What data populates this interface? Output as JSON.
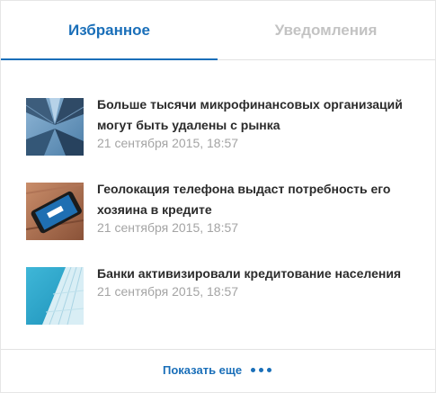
{
  "tabs": [
    {
      "label": "Избранное",
      "active": true
    },
    {
      "label": "Уведомления",
      "active": false
    }
  ],
  "news": [
    {
      "title": "Больше тысячи микрофинансовых организаций могут быть удалены с рынка",
      "date": "21 сентября 2015, 18:57",
      "thumb": "skyscrapers-photo"
    },
    {
      "title": "Геолокация телефона выдаст потребность его хозяина в кредите",
      "date": "21 сентября 2015, 18:57",
      "thumb": "smartphone-photo"
    },
    {
      "title": "Банки активизировали кредитование населения",
      "date": "21 сентября 2015, 18:57",
      "thumb": "glass-building-photo"
    }
  ],
  "footer": {
    "show_more_label": "Показать еще",
    "icon": "more-dots-icon"
  },
  "colors": {
    "accent": "#1a6fb9",
    "inactive_tab": "#c3c3c3",
    "date": "#a4a4a4"
  }
}
